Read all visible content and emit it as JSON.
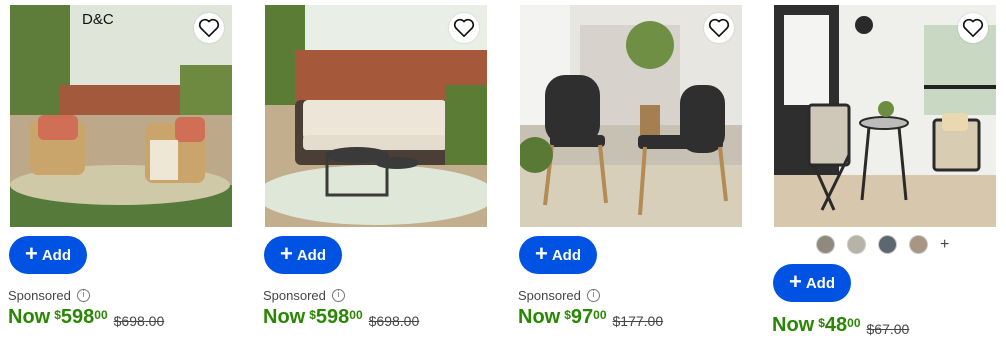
{
  "products": [
    {
      "brand_mark": "D&C",
      "add_label": "Add",
      "sponsored_label": "Sponsored",
      "price_prefix": "Now",
      "currency": "$",
      "price_dollars": "598",
      "price_cents": "00",
      "was_price": "$698.00",
      "favorite_icon": "heart-outline-icon"
    },
    {
      "add_label": "Add",
      "sponsored_label": "Sponsored",
      "price_prefix": "Now",
      "currency": "$",
      "price_dollars": "598",
      "price_cents": "00",
      "was_price": "$698.00",
      "favorite_icon": "heart-outline-icon"
    },
    {
      "add_label": "Add",
      "sponsored_label": "Sponsored",
      "price_prefix": "Now",
      "currency": "$",
      "price_dollars": "97",
      "price_cents": "00",
      "was_price": "$177.00",
      "favorite_icon": "heart-outline-icon"
    },
    {
      "add_label": "Add",
      "price_prefix": "Now",
      "currency": "$",
      "price_dollars": "48",
      "price_cents": "00",
      "was_price": "$67.00",
      "favorite_icon": "heart-outline-icon",
      "swatch_more": "+",
      "swatch_colors": [
        "#8f8a7d",
        "#b7b3a6",
        "#5e6670",
        "#a89583"
      ]
    }
  ],
  "colors": {
    "accent_blue": "#0053e2",
    "price_green": "#2a8703",
    "text_gray": "#46474a"
  }
}
